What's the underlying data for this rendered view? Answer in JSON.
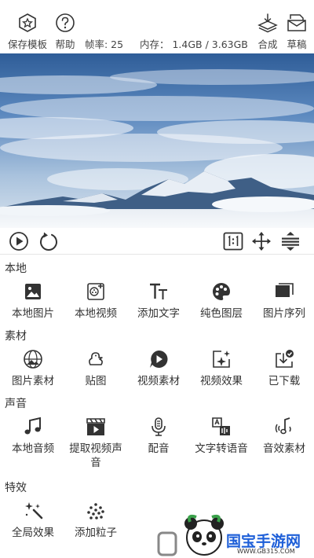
{
  "topbar": {
    "save_template": "保存模板",
    "help": "帮助",
    "fps": "帧率: 25",
    "memory": "内存：  1.4GB / 3.63GB",
    "compose": "合成",
    "draft": "草稿"
  },
  "sections": {
    "local": {
      "title": "本地",
      "items": [
        "本地图片",
        "本地视频",
        "添加文字",
        "纯色图层",
        "图片序列"
      ]
    },
    "material": {
      "title": "素材",
      "items": [
        "图片素材",
        "贴图",
        "视频素材",
        "视频效果",
        "已下载"
      ]
    },
    "sound": {
      "title": "声音",
      "items": [
        "本地音频",
        "提取视频声音",
        "配音",
        "文字转语音",
        "音效素材"
      ]
    },
    "effects": {
      "title": "特效",
      "items": [
        "全局效果",
        "添加粒子"
      ]
    }
  },
  "watermark": {
    "brand": "国宝手游网",
    "site": "WWW.GB315.COM"
  },
  "icons": {
    "save_template": "star-hexagon-icon",
    "help": "question-circle-icon",
    "compose": "layers-download-icon",
    "draft": "envelope-icon",
    "play": "play-circle-icon",
    "replay": "replay-icon",
    "ratio": "aspect-ratio-icon",
    "move": "move-arrows-icon",
    "align": "align-center-icon"
  },
  "colors": {
    "icon": "#333333",
    "divider": "#e6e6e6",
    "sky": "#4a7bb5",
    "brand_blue": "#1e5fd8"
  }
}
